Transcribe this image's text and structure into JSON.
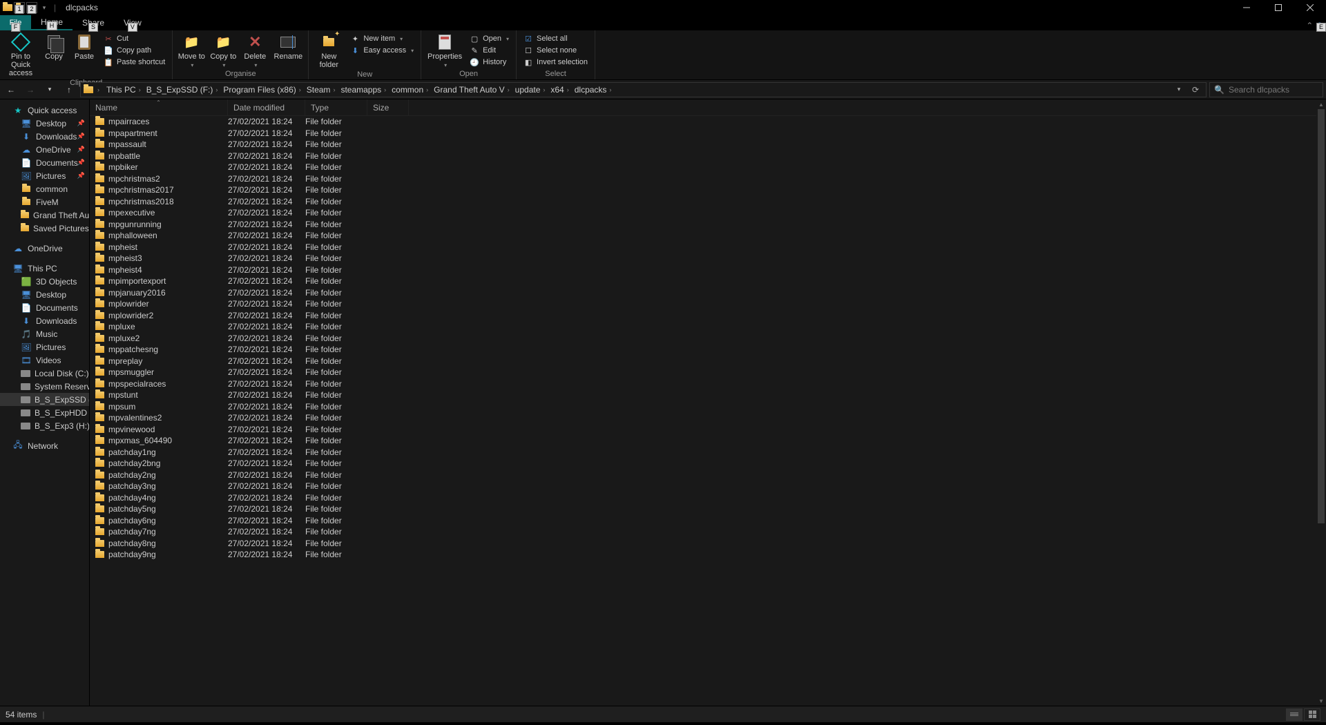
{
  "window": {
    "title": "dlcpacks"
  },
  "keyhints": {
    "file": "F",
    "home": "H",
    "share": "S",
    "view": "V",
    "qat1": "1",
    "qat2": "2",
    "help": "E"
  },
  "tabs": {
    "file": "File",
    "home": "Home",
    "share": "Share",
    "view": "View"
  },
  "ribbon": {
    "clipboard": {
      "label": "Clipboard",
      "pin": "Pin to Quick access",
      "copy": "Copy",
      "paste": "Paste",
      "cut": "Cut",
      "copypath": "Copy path",
      "pasteshortcut": "Paste shortcut"
    },
    "organise": {
      "label": "Organise",
      "moveto": "Move to",
      "copyto": "Copy to",
      "delete": "Delete",
      "rename": "Rename"
    },
    "new": {
      "label": "New",
      "newfolder": "New folder",
      "newitem": "New item",
      "easyaccess": "Easy access"
    },
    "open": {
      "label": "Open",
      "properties": "Properties",
      "open": "Open",
      "edit": "Edit",
      "history": "History"
    },
    "select": {
      "label": "Select",
      "selectall": "Select all",
      "selectnone": "Select none",
      "invert": "Invert selection"
    }
  },
  "breadcrumbs": [
    "This PC",
    "B_S_ExpSSD (F:)",
    "Program Files (x86)",
    "Steam",
    "steamapps",
    "common",
    "Grand Theft Auto V",
    "update",
    "x64",
    "dlcpacks"
  ],
  "search": {
    "placeholder": "Search dlcpacks"
  },
  "sidebar": {
    "quickaccess": {
      "label": "Quick access",
      "items": [
        "Desktop",
        "Downloads",
        "OneDrive",
        "Documents",
        "Pictures",
        "common",
        "FiveM",
        "Grand Theft Auto V",
        "Saved Pictures"
      ],
      "pinned": [
        true,
        true,
        true,
        true,
        true,
        false,
        false,
        false,
        false
      ]
    },
    "onedrive": "OneDrive",
    "thispc": {
      "label": "This PC",
      "items": [
        "3D Objects",
        "Desktop",
        "Documents",
        "Downloads",
        "Music",
        "Pictures",
        "Videos",
        "Local Disk (C:)",
        "System Reserved (E:)",
        "B_S_ExpSSD (F:)",
        "B_S_ExpHDD (G:)",
        "B_S_Exp3 (H:)"
      ]
    },
    "network": "Network"
  },
  "columns": {
    "name": "Name",
    "date": "Date modified",
    "type": "Type",
    "size": "Size"
  },
  "filetype": "File folder",
  "filedate": "27/02/2021 18:24",
  "files": [
    "mpairraces",
    "mpapartment",
    "mpassault",
    "mpbattle",
    "mpbiker",
    "mpchristmas2",
    "mpchristmas2017",
    "mpchristmas2018",
    "mpexecutive",
    "mpgunrunning",
    "mphalloween",
    "mpheist",
    "mpheist3",
    "mpheist4",
    "mpimportexport",
    "mpjanuary2016",
    "mplowrider",
    "mplowrider2",
    "mpluxe",
    "mpluxe2",
    "mppatchesng",
    "mpreplay",
    "mpsmuggler",
    "mpspecialraces",
    "mpstunt",
    "mpsum",
    "mpvalentines2",
    "mpvinewood",
    "mpxmas_604490",
    "patchday1ng",
    "patchday2bng",
    "patchday2ng",
    "patchday3ng",
    "patchday4ng",
    "patchday5ng",
    "patchday6ng",
    "patchday7ng",
    "patchday8ng",
    "patchday9ng"
  ],
  "status": {
    "count": "54 items"
  }
}
